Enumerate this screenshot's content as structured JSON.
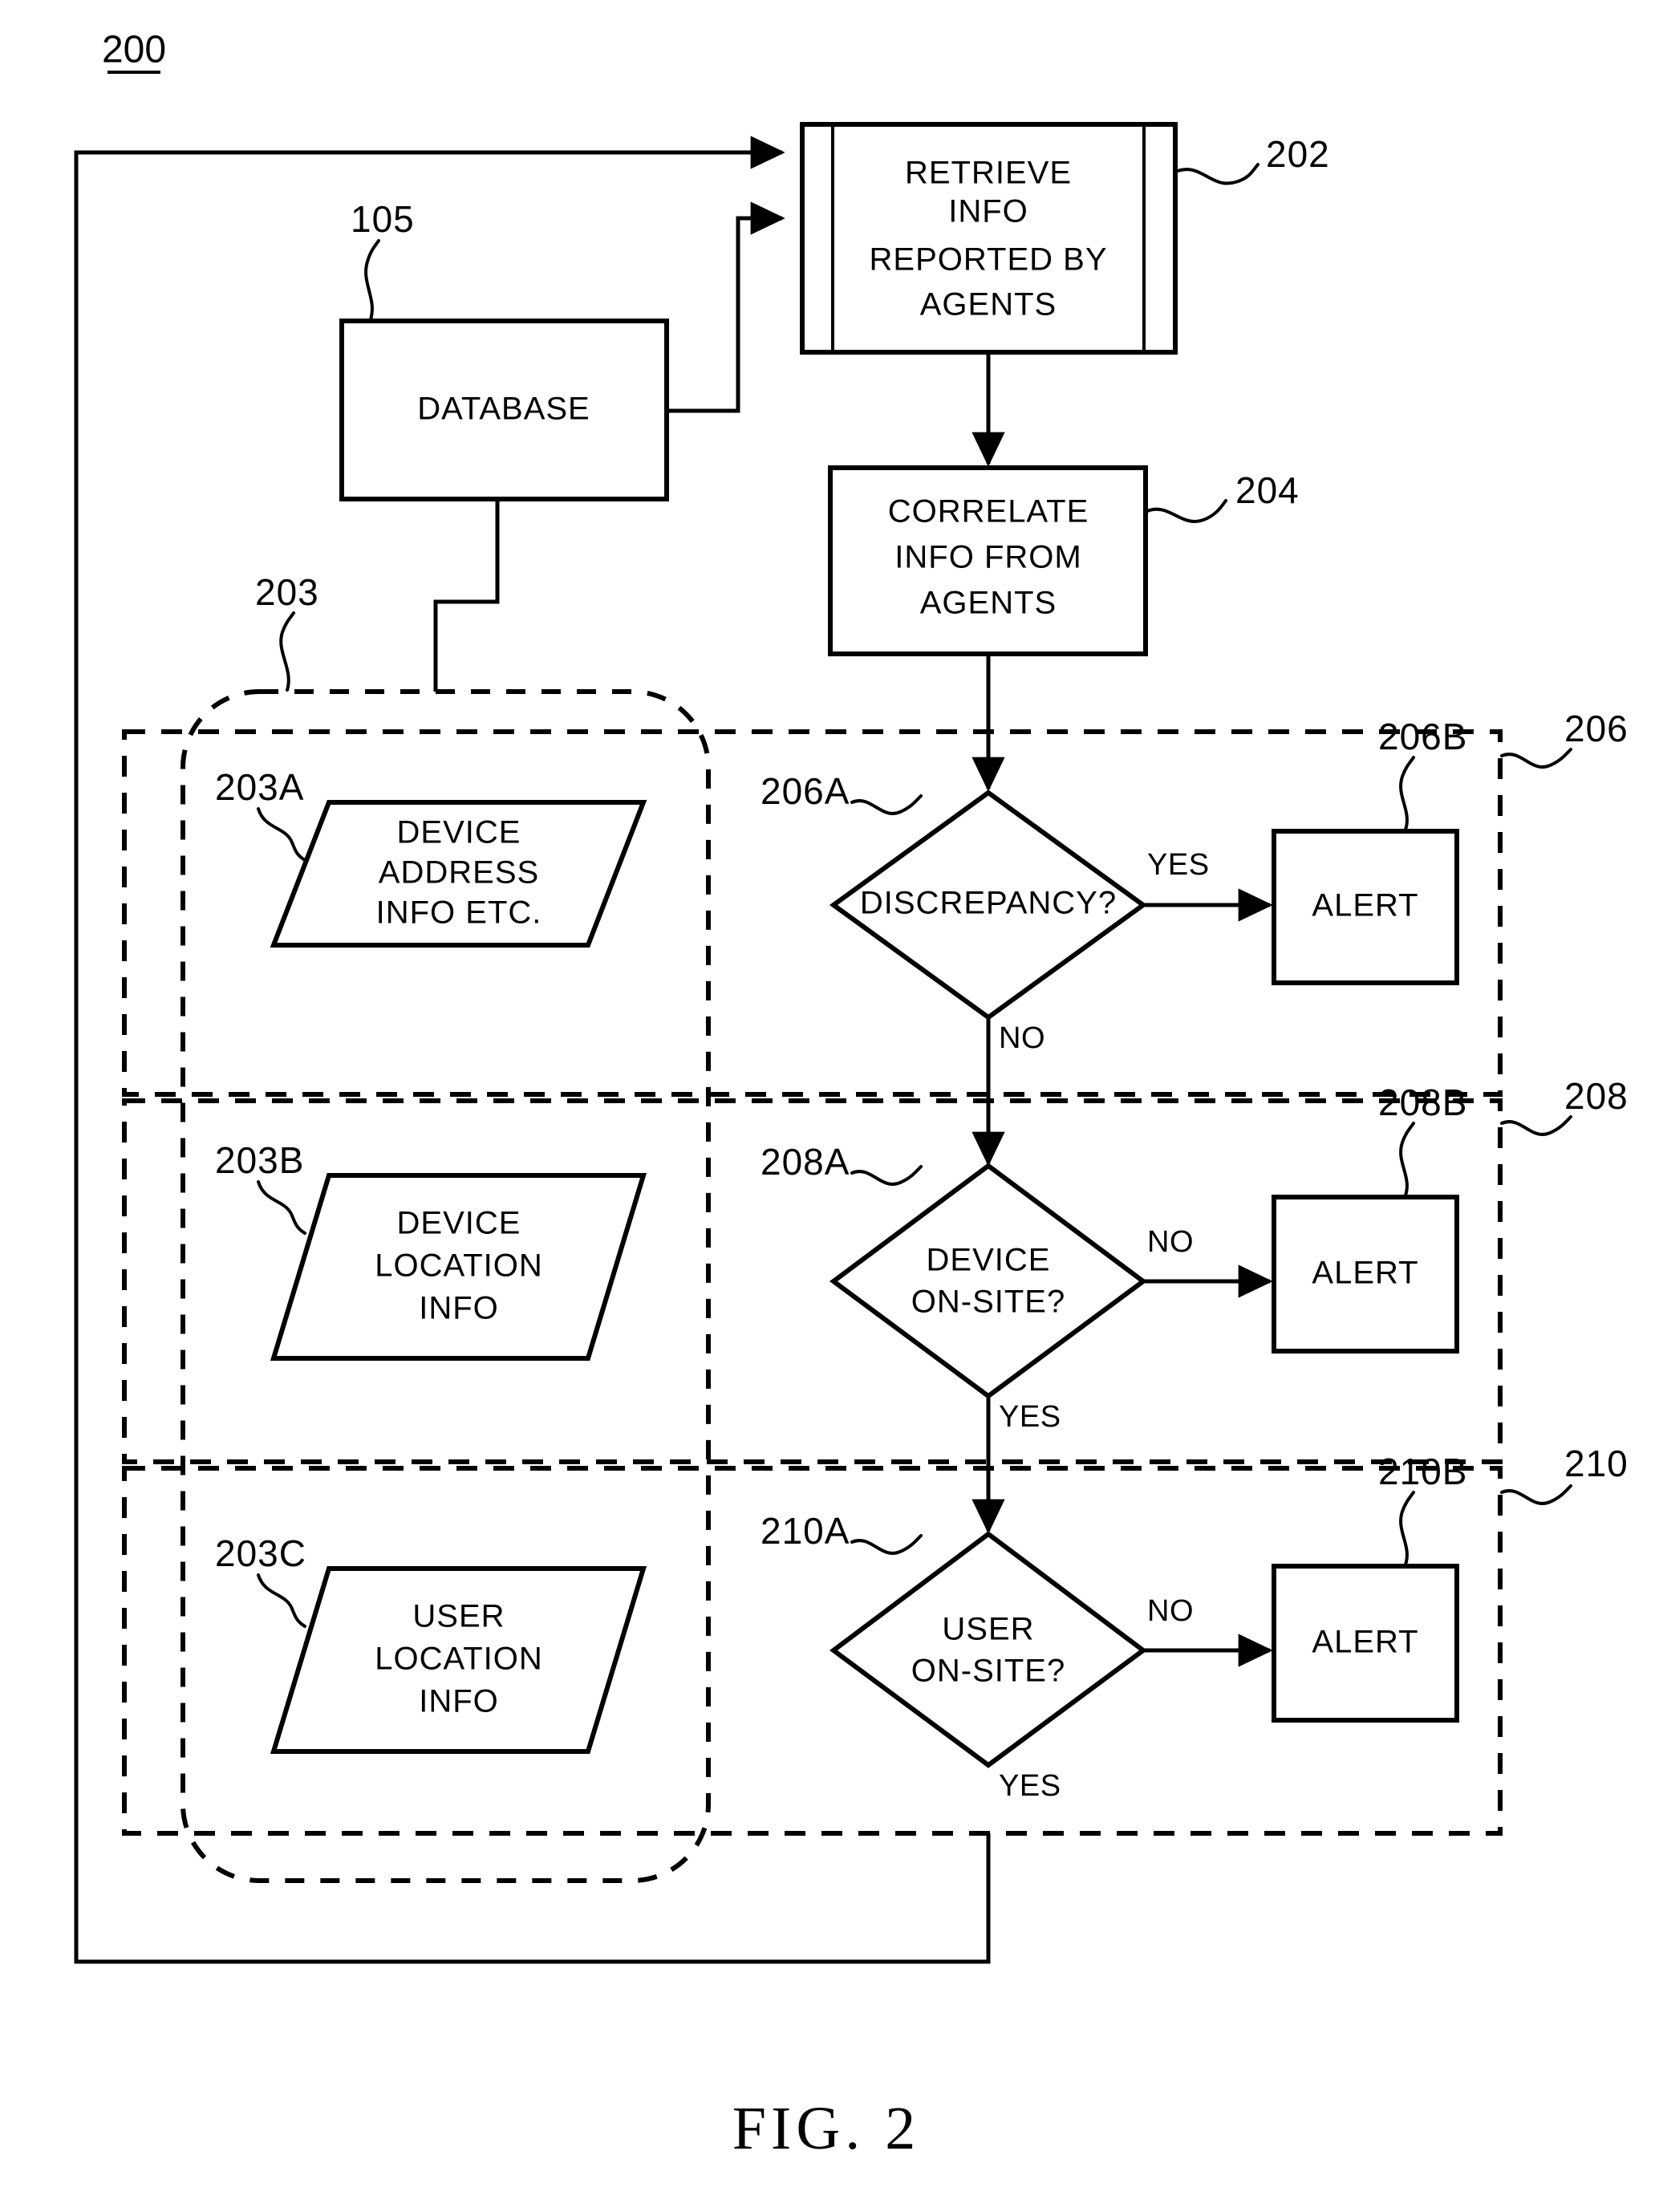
{
  "figure": {
    "caption": "FIG. 2",
    "diagram_number": "200"
  },
  "nodes": {
    "retrieve": {
      "ref": "202",
      "type": "predefined-process",
      "lines": [
        "RETRIEVE",
        "INFO",
        "REPORTED BY",
        "AGENTS"
      ]
    },
    "database": {
      "ref": "105",
      "type": "process",
      "label": "DATABASE"
    },
    "correlate": {
      "ref": "204",
      "type": "process",
      "lines": [
        "CORRELATE",
        "INFO FROM",
        "AGENTS"
      ]
    },
    "device_address_info": {
      "ref": "203A",
      "type": "data",
      "lines": [
        "DEVICE",
        "ADDRESS",
        "INFO ETC."
      ]
    },
    "device_location_info": {
      "ref": "203B",
      "type": "data",
      "lines": [
        "DEVICE",
        "LOCATION",
        "INFO"
      ]
    },
    "user_location_info": {
      "ref": "203C",
      "type": "data",
      "lines": [
        "USER",
        "LOCATION",
        "INFO"
      ]
    },
    "discrepancy_decision": {
      "ref": "206A",
      "type": "decision",
      "lines": [
        "DISCREPANCY?"
      ]
    },
    "device_onsite_decision": {
      "ref": "208A",
      "type": "decision",
      "lines": [
        "DEVICE",
        "ON-SITE?"
      ]
    },
    "user_onsite_decision": {
      "ref": "210A",
      "type": "decision",
      "lines": [
        "USER",
        "ON-SITE?"
      ]
    },
    "alert_206b": {
      "ref": "206B",
      "type": "process",
      "label": "ALERT"
    },
    "alert_208b": {
      "ref": "208B",
      "type": "process",
      "label": "ALERT"
    },
    "alert_210b": {
      "ref": "210B",
      "type": "process",
      "label": "ALERT"
    }
  },
  "groups": {
    "data_group": {
      "ref": "203",
      "type": "rounded-dashed-container"
    },
    "stage_206": {
      "ref": "206",
      "type": "dashed-container"
    },
    "stage_208": {
      "ref": "208",
      "type": "dashed-container"
    },
    "stage_210": {
      "ref": "210",
      "type": "dashed-container"
    }
  },
  "edges": {
    "discrepancy_yes": "YES",
    "discrepancy_no": "NO",
    "device_onsite_no": "NO",
    "device_onsite_yes": "YES",
    "user_onsite_no": "NO",
    "user_onsite_yes": "YES"
  },
  "colors": {
    "ink": "#000000",
    "paper": "#ffffff"
  }
}
